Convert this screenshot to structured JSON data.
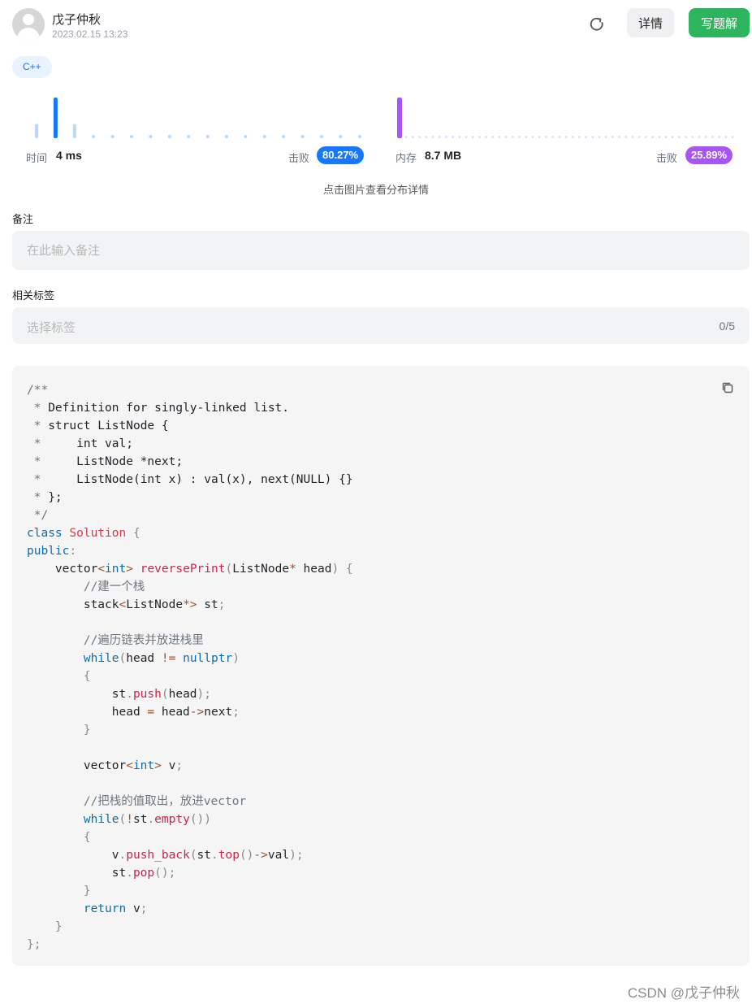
{
  "header": {
    "author_name": "戊子仲秋",
    "post_time": "2023.02.15 13:23",
    "refresh_icon": "refresh-icon",
    "detail_label": "详情",
    "write_solution_label": "写题解"
  },
  "language_tag": "C++",
  "stats": {
    "time_label": "时间",
    "time_value": "4 ms",
    "time_beat_label": "击败",
    "time_beat_pct": "80.27%",
    "memory_label": "内存",
    "memory_value": "8.7 MB",
    "memory_beat_label": "击败",
    "memory_beat_pct": "25.89%",
    "time_color": "#1677ff",
    "memory_color": "#a855f7",
    "hint": "点击图片查看分布详情"
  },
  "chart_data": [
    {
      "type": "bar",
      "title": "",
      "xlabel": "时间",
      "ylabel": "",
      "series": [
        {
          "values": [
            0.35,
            1.0,
            0.35,
            0.08,
            0.08,
            0.08,
            0.08,
            0.08,
            0.08,
            0.08,
            0.08,
            0.08,
            0.08,
            0.08,
            0.08,
            0.08,
            0.08,
            0.08
          ]
        }
      ],
      "highlight_index": 1,
      "colors": {
        "bar": "#b8d8fb",
        "highlight": "#1677ff"
      }
    },
    {
      "type": "bar",
      "title": "",
      "xlabel": "内存",
      "ylabel": "",
      "series": [
        {
          "values": [
            1.0,
            0.06,
            0.06,
            0.06,
            0.06,
            0.06,
            0.06,
            0.06,
            0.06,
            0.06,
            0.06,
            0.06,
            0.06,
            0.06,
            0.06,
            0.06,
            0.06,
            0.06,
            0.06,
            0.06,
            0.06,
            0.06,
            0.06,
            0.06,
            0.06,
            0.06,
            0.06,
            0.06,
            0.06,
            0.06,
            0.06,
            0.06,
            0.06,
            0.06,
            0.06,
            0.06,
            0.06,
            0.06,
            0.06,
            0.06,
            0.06,
            0.06,
            0.06,
            0.06,
            0.06,
            0.06,
            0.06,
            0.06,
            0.06,
            0.06,
            0.06
          ]
        }
      ],
      "highlight_index": 0,
      "colors": {
        "bar": "#edd9fb",
        "highlight": "#a855f7"
      }
    }
  ],
  "note": {
    "label": "备注",
    "placeholder": "在此输入备注",
    "value": ""
  },
  "tags": {
    "label": "相关标签",
    "placeholder": "选择标签",
    "count": "0/5"
  },
  "code": {
    "copy_icon": "copy-icon",
    "language": "C++"
  },
  "watermark": "CSDN @戊子仲秋"
}
